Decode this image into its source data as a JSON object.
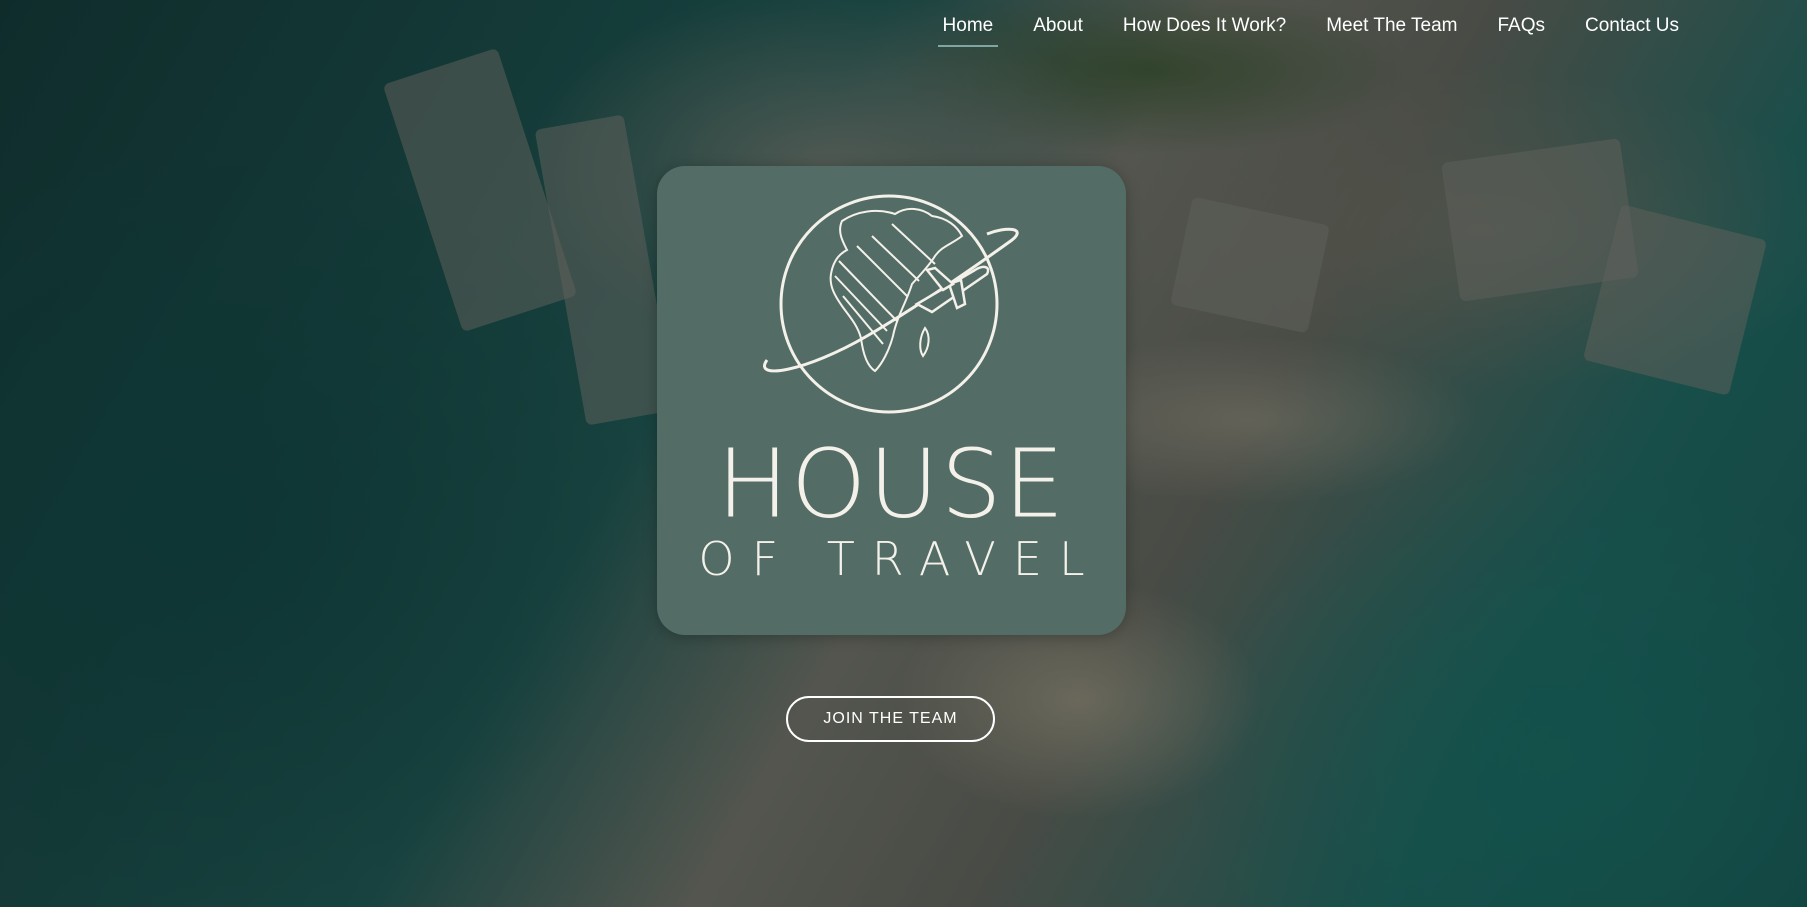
{
  "nav": {
    "items": [
      {
        "label": "Home",
        "active": true
      },
      {
        "label": "About"
      },
      {
        "label": "How Does It Work?"
      },
      {
        "label": "Meet The Team"
      },
      {
        "label": "FAQs"
      },
      {
        "label": "Contact Us"
      }
    ]
  },
  "logo": {
    "line1": "HOUSE",
    "line2": "OF TRAVEL",
    "icon": "globe-with-airplane-icon"
  },
  "hero": {
    "cta_label": "JOIN THE TEAM",
    "background": "aerial beach and ocean photo"
  },
  "colors": {
    "card": "#536d66",
    "accent_underline": "#7fa6a0",
    "text": "#ffffff"
  }
}
